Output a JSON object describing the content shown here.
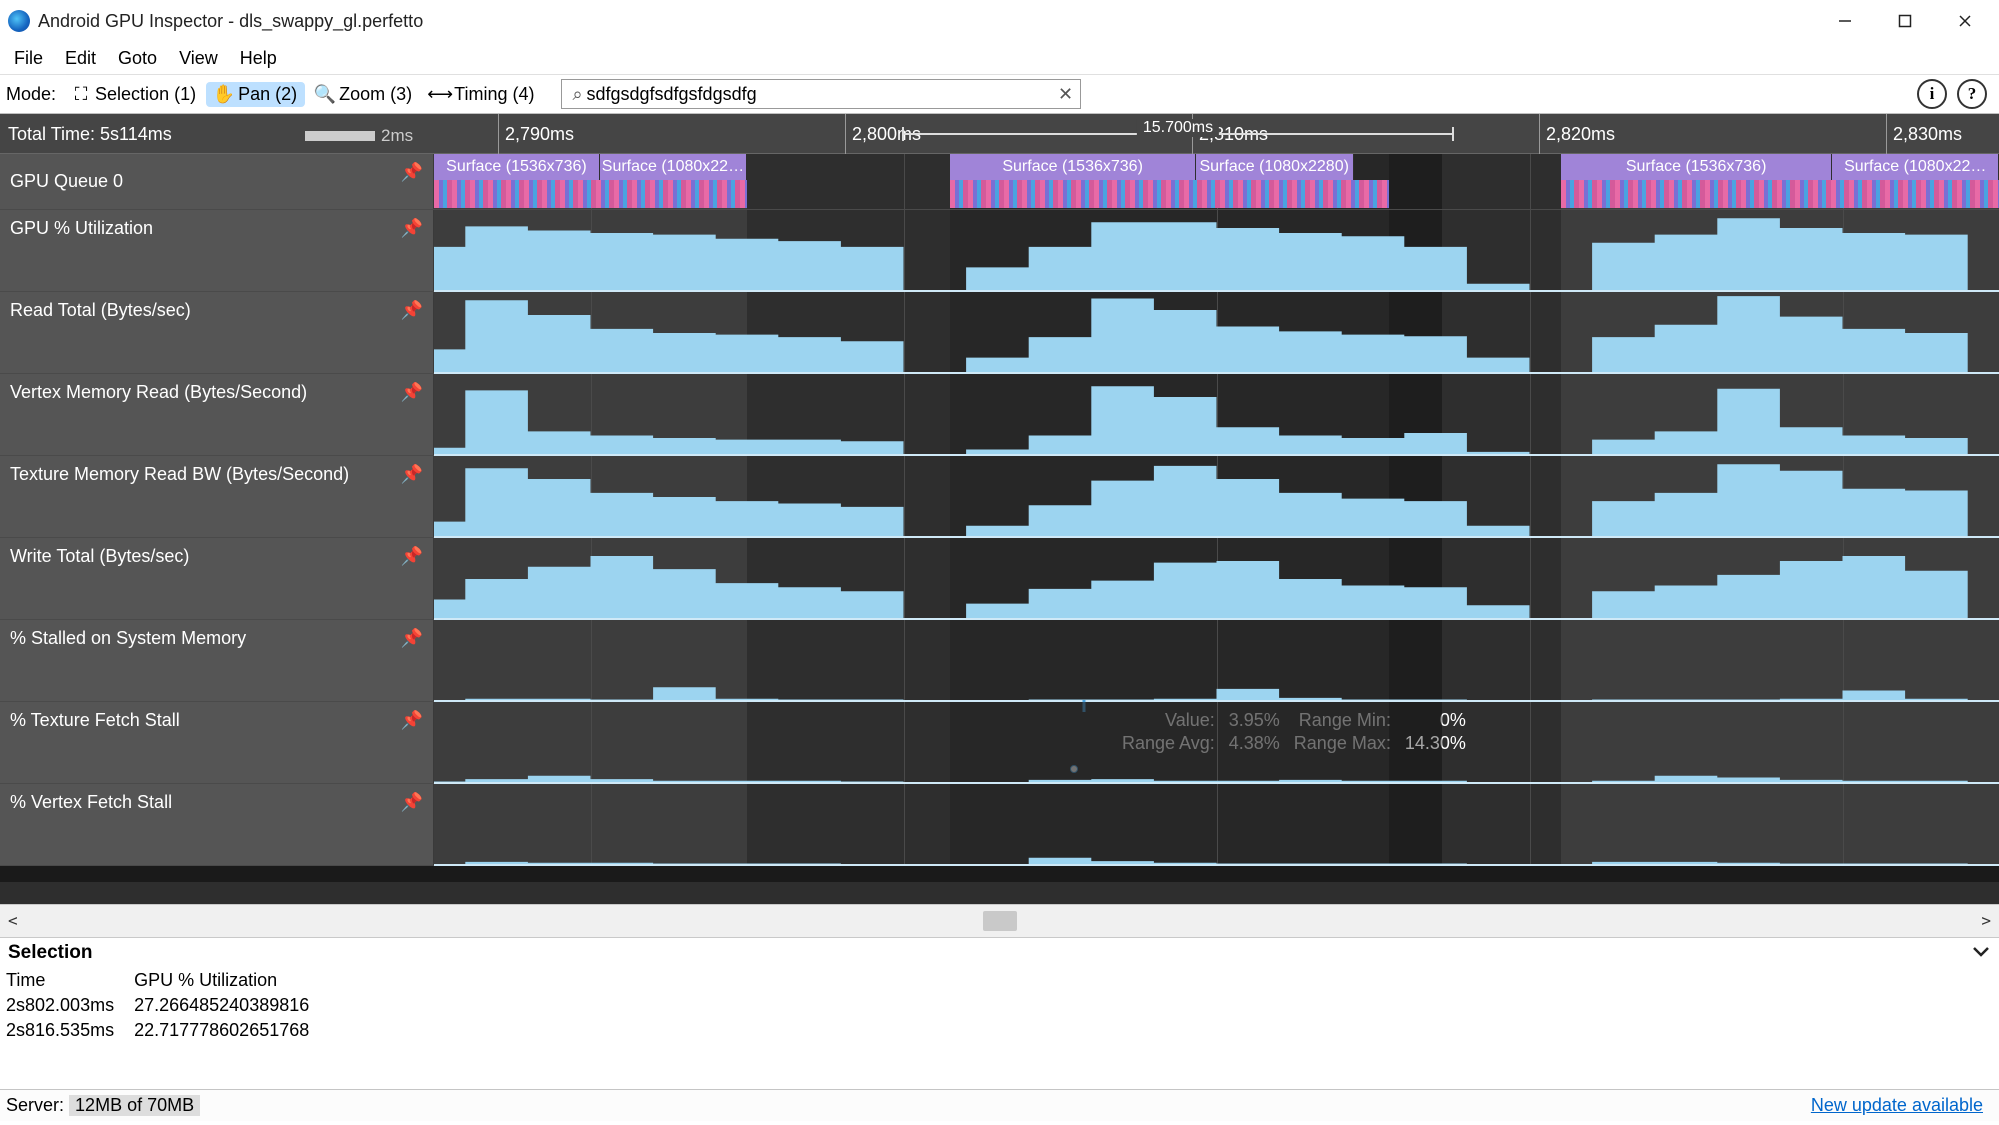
{
  "window": {
    "title": "Android GPU Inspector - dls_swappy_gl.perfetto"
  },
  "menus": [
    "File",
    "Edit",
    "Goto",
    "View",
    "Help"
  ],
  "modebar": {
    "label": "Mode:",
    "modes": [
      {
        "id": "selection",
        "label": "Selection (1)",
        "active": false
      },
      {
        "id": "pan",
        "label": "Pan (2)",
        "active": true
      },
      {
        "id": "zoom",
        "label": "Zoom (3)",
        "active": false
      },
      {
        "id": "timing",
        "label": "Timing (4)",
        "active": false
      }
    ],
    "search_value": "sdfgsdgfsdfgsfdgsdfg"
  },
  "ruler": {
    "total_time": "Total Time: 5s114ms",
    "scale_hint": "2ms",
    "ticks": [
      "2,790ms",
      "2,800ms",
      "2,810ms",
      "2,820ms",
      "2,830ms"
    ],
    "selection_span": "15.700ms"
  },
  "tracks": {
    "queue": {
      "label": "GPU Queue 0",
      "frames": [
        {
          "spans": [
            {
              "label": "Surface (1536x736)",
              "w": 0.53
            },
            {
              "label": "Surface (1080x22…",
              "w": 0.47
            }
          ]
        },
        {
          "spans": [
            {
              "label": "Surface (1536x736)",
              "w": 0.56
            },
            {
              "label": "Surface (1080x2280)",
              "w": 0.36
            }
          ]
        },
        {
          "spans": [
            {
              "label": "Surface (1536x736)",
              "w": 0.62
            },
            {
              "label": "Surface (1080x22…",
              "w": 0.38
            }
          ]
        }
      ]
    },
    "rows": [
      {
        "id": "util",
        "label": "GPU % Utilization"
      },
      {
        "id": "read",
        "label": "Read Total (Bytes/sec)"
      },
      {
        "id": "vmr",
        "label": "Vertex Memory Read (Bytes/Second)"
      },
      {
        "id": "tmr",
        "label": "Texture Memory Read BW (Bytes/Second)"
      },
      {
        "id": "write",
        "label": "Write Total (Bytes/sec)"
      },
      {
        "id": "stall",
        "label": "% Stalled on System Memory"
      },
      {
        "id": "tex",
        "label": "% Texture Fetch Stall"
      },
      {
        "id": "vtx",
        "label": "% Vertex Fetch Stall"
      }
    ]
  },
  "tooltip": {
    "k1": "Value:",
    "v1": "3.95%",
    "k2": "Range Min:",
    "v2": "0%",
    "k3": "Range Avg:",
    "v3": "4.38%",
    "k4": "Range Max:",
    "v4": "14.30%"
  },
  "selection_panel": {
    "title": "Selection",
    "cols": [
      "Time",
      "GPU % Utilization"
    ],
    "rows": [
      [
        "2s802.003ms",
        "27.266485240389816"
      ],
      [
        "2s816.535ms",
        "22.717778602651768"
      ]
    ]
  },
  "statusbar": {
    "server_label": "Server:",
    "server_mem": "12MB of 70MB",
    "update_link": "New update available"
  },
  "chart_data": {
    "type": "area",
    "note": "Eight stacked step-area counter tracks over ~50ms window (2,785–2,835ms). Three active frame intervals; gaps between frames are idle. Selection brackets span ~15.7ms centered near 2,810ms. Values are relative heights 0–1 per track, read off step profiles.",
    "x_ms": [
      2785,
      2786,
      2788,
      2790,
      2792,
      2794,
      2796,
      2798,
      2800,
      2802,
      2804,
      2806,
      2808,
      2810,
      2812,
      2814,
      2816,
      2818,
      2820,
      2822,
      2824,
      2826,
      2828,
      2830,
      2832,
      2834
    ],
    "series": [
      {
        "name": "GPU % Utilization",
        "values": [
          0.55,
          0.8,
          0.75,
          0.72,
          0.7,
          0.65,
          0.62,
          0.55,
          0.0,
          0.3,
          0.55,
          0.85,
          0.85,
          0.78,
          0.72,
          0.68,
          0.55,
          0.1,
          0.0,
          0.6,
          0.7,
          0.9,
          0.78,
          0.72,
          0.7,
          0.65
        ]
      },
      {
        "name": "Read Total (Bytes/sec)",
        "values": [
          0.3,
          0.9,
          0.72,
          0.55,
          0.5,
          0.48,
          0.45,
          0.4,
          0.0,
          0.2,
          0.45,
          0.92,
          0.78,
          0.58,
          0.52,
          0.48,
          0.46,
          0.2,
          0.0,
          0.45,
          0.6,
          0.95,
          0.7,
          0.55,
          0.5,
          0.48
        ]
      },
      {
        "name": "Vertex Memory Read (Bytes/Second)",
        "values": [
          0.1,
          0.8,
          0.3,
          0.25,
          0.22,
          0.2,
          0.2,
          0.18,
          0.0,
          0.08,
          0.25,
          0.85,
          0.72,
          0.35,
          0.25,
          0.22,
          0.28,
          0.05,
          0.0,
          0.2,
          0.3,
          0.82,
          0.35,
          0.25,
          0.22,
          0.22
        ]
      },
      {
        "name": "Texture Memory Read BW (Bytes/Second)",
        "values": [
          0.2,
          0.85,
          0.72,
          0.55,
          0.5,
          0.45,
          0.42,
          0.38,
          0.0,
          0.15,
          0.4,
          0.7,
          0.88,
          0.72,
          0.55,
          0.48,
          0.45,
          0.15,
          0.0,
          0.45,
          0.55,
          0.9,
          0.82,
          0.6,
          0.58,
          0.55
        ]
      },
      {
        "name": "Write Total (Bytes/sec)",
        "values": [
          0.25,
          0.5,
          0.65,
          0.78,
          0.62,
          0.45,
          0.4,
          0.35,
          0.0,
          0.2,
          0.38,
          0.48,
          0.7,
          0.72,
          0.5,
          0.42,
          0.4,
          0.18,
          0.0,
          0.35,
          0.42,
          0.55,
          0.72,
          0.78,
          0.6,
          0.52
        ]
      },
      {
        "name": "% Stalled on System Memory",
        "values": [
          0.02,
          0.04,
          0.04,
          0.03,
          0.18,
          0.04,
          0.03,
          0.03,
          0.0,
          0.02,
          0.03,
          0.03,
          0.04,
          0.16,
          0.05,
          0.03,
          0.03,
          0.02,
          0.0,
          0.03,
          0.03,
          0.03,
          0.04,
          0.14,
          0.04,
          0.03
        ]
      },
      {
        "name": "% Texture Fetch Stall",
        "values": [
          0.03,
          0.06,
          0.1,
          0.06,
          0.04,
          0.04,
          0.04,
          0.03,
          0.0,
          0.02,
          0.05,
          0.06,
          0.04,
          0.04,
          0.05,
          0.04,
          0.04,
          0.02,
          0.0,
          0.04,
          0.1,
          0.08,
          0.05,
          0.04,
          0.04,
          0.04
        ]
      },
      {
        "name": "% Vertex Fetch Stall",
        "values": [
          0.02,
          0.05,
          0.04,
          0.04,
          0.03,
          0.03,
          0.03,
          0.02,
          0.0,
          0.02,
          0.1,
          0.06,
          0.04,
          0.03,
          0.03,
          0.03,
          0.03,
          0.02,
          0.0,
          0.05,
          0.05,
          0.04,
          0.03,
          0.03,
          0.03,
          0.03
        ]
      }
    ],
    "frame_intervals_ms": [
      [
        2785.0,
        2795.0
      ],
      [
        2801.5,
        2815.5
      ],
      [
        2821.0,
        2835.0
      ]
    ],
    "selection_ms": [
      2801.5,
      2817.2
    ],
    "xlim_ms": [
      2785,
      2835
    ]
  }
}
